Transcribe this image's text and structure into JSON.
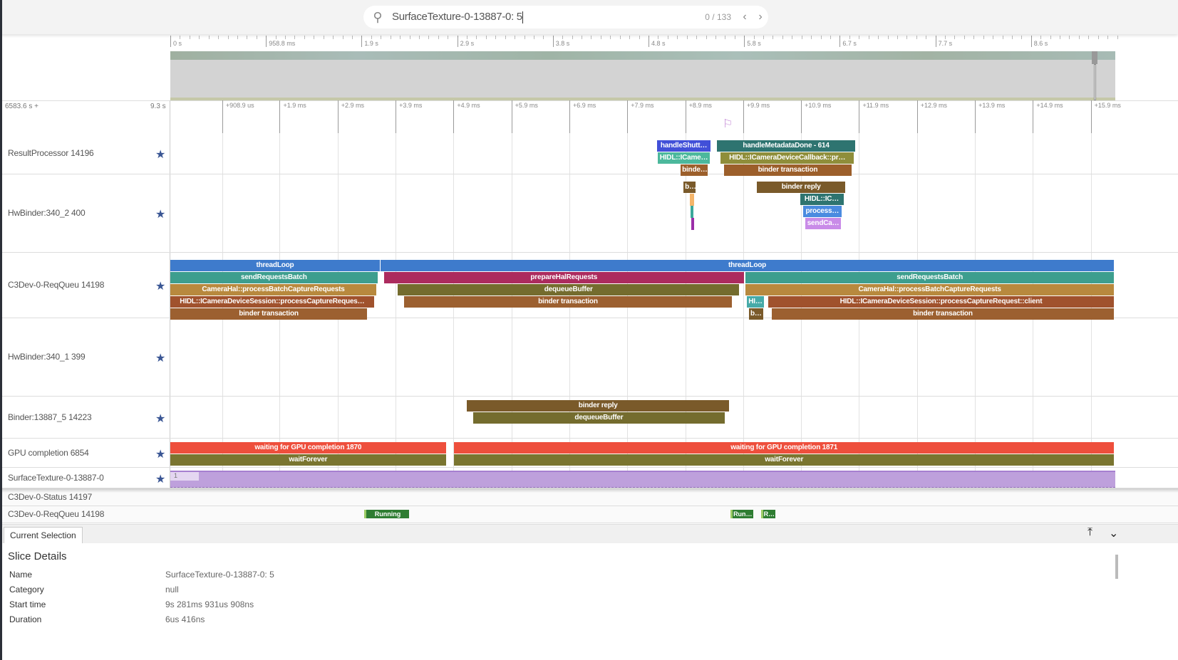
{
  "search": {
    "query": "SurfaceTexture-0-13887-0: 5",
    "count": "0 / 133",
    "icon": "search-icon"
  },
  "overview_ticks": [
    "0 s",
    "958.8 ms",
    "1.9 s",
    "2.9 s",
    "3.8 s",
    "4.8 s",
    "5.8 s",
    "6.7 s",
    "7.7 s",
    "8.6 s"
  ],
  "time_header": {
    "offset": "6583.6 s +",
    "span": "9.3 s"
  },
  "ticks": [
    {
      "t": 0.9089,
      "label": "+908.9 us"
    },
    {
      "t": 1.9,
      "label": "+1.9 ms"
    },
    {
      "t": 2.9,
      "label": "+2.9 ms"
    },
    {
      "t": 3.9,
      "label": "+3.9 ms"
    },
    {
      "t": 4.9,
      "label": "+4.9 ms"
    },
    {
      "t": 5.9,
      "label": "+5.9 ms"
    },
    {
      "t": 6.9,
      "label": "+6.9 ms"
    },
    {
      "t": 7.9,
      "label": "+7.9 ms"
    },
    {
      "t": 8.9,
      "label": "+8.9 ms"
    },
    {
      "t": 9.9,
      "label": "+9.9 ms"
    },
    {
      "t": 10.9,
      "label": "+10.9 ms"
    },
    {
      "t": 11.9,
      "label": "+11.9 ms"
    },
    {
      "t": 12.9,
      "label": "+12.9 ms"
    },
    {
      "t": 13.9,
      "label": "+13.9 ms"
    },
    {
      "t": 14.9,
      "label": "+14.9 ms"
    },
    {
      "t": 15.9,
      "label": "+15.9 ms"
    }
  ],
  "tracks": [
    {
      "name": "ResultProcessor 14196",
      "pinned": true,
      "slices": [
        {
          "s": 8.41,
          "e": 9.34,
          "d": 0,
          "label": "handleShutt…",
          "color": "#4150d8"
        },
        {
          "s": 8.43,
          "e": 9.32,
          "d": 1,
          "label": "HIDL::ICame…",
          "color": "#4cb89c"
        },
        {
          "s": 8.82,
          "e": 9.29,
          "d": 2,
          "label": "binde…",
          "color": "#9c5f2b"
        },
        {
          "s": 9.45,
          "e": 11.83,
          "d": 0,
          "label": "handleMetadataDone - 614",
          "color": "#2e7470"
        },
        {
          "s": 9.51,
          "e": 11.81,
          "d": 1,
          "label": "HIDL::ICameraDeviceCallback::pr…",
          "color": "#8f8e3a"
        },
        {
          "s": 9.57,
          "e": 11.77,
          "d": 2,
          "label": "binder transaction",
          "color": "#9c5f2b"
        }
      ]
    },
    {
      "name": "HwBinder:340_2 400",
      "pinned": true,
      "slices": [
        {
          "s": 8.87,
          "e": 9.08,
          "d": 0,
          "label": "b…",
          "color": "#7a5a2a"
        },
        {
          "s": 8.98,
          "e": 9.05,
          "d": 1,
          "label": "",
          "color": "#f5b56a"
        },
        {
          "s": 8.99,
          "e": 9.04,
          "d": 2,
          "label": "",
          "color": "#3aa89a"
        },
        {
          "s": 9.0,
          "e": 9.03,
          "d": 3,
          "label": "",
          "color": "#9b2fa8"
        },
        {
          "s": 10.14,
          "e": 11.66,
          "d": 0,
          "label": "binder reply",
          "color": "#7a5a2a"
        },
        {
          "s": 10.88,
          "e": 11.63,
          "d": 1,
          "label": "HIDL::IC…",
          "color": "#2e7470"
        },
        {
          "s": 10.93,
          "e": 11.6,
          "d": 2,
          "label": "process…",
          "color": "#4a8be0"
        },
        {
          "s": 10.97,
          "e": 11.59,
          "d": 3,
          "label": "sendCa…",
          "color": "#c98be8"
        }
      ]
    },
    {
      "name": "C3Dev-0-ReqQueu 14198",
      "pinned": true,
      "slices": [
        {
          "s": 0.01,
          "e": 3.63,
          "d": 0,
          "label": "threadLoop",
          "color": "#3e7bcc"
        },
        {
          "s": 3.64,
          "e": 16.3,
          "d": 0,
          "label": "threadLoop",
          "color": "#3e7bcc"
        },
        {
          "s": 0.01,
          "e": 3.59,
          "d": 1,
          "label": "sendRequestsBatch",
          "color": "#3d9e8e"
        },
        {
          "s": 3.7,
          "e": 9.91,
          "d": 1,
          "label": "prepareHalRequests",
          "color": "#ac2b5e"
        },
        {
          "s": 9.94,
          "e": 16.3,
          "d": 1,
          "label": "sendRequestsBatch",
          "color": "#3d9e8e"
        },
        {
          "s": 0.01,
          "e": 3.57,
          "d": 2,
          "label": "CameraHal::processBatchCaptureRequests",
          "color": "#b8893e"
        },
        {
          "s": 3.94,
          "e": 9.83,
          "d": 2,
          "label": "dequeueBuffer",
          "color": "#746c2e"
        },
        {
          "s": 9.94,
          "e": 16.3,
          "d": 2,
          "label": "CameraHal::processBatchCaptureRequests",
          "color": "#b8893e"
        },
        {
          "s": 0.01,
          "e": 3.53,
          "d": 3,
          "label": "HIDL::ICameraDeviceSession::processCaptureReques…",
          "color": "#a0522d"
        },
        {
          "s": 4.05,
          "e": 9.7,
          "d": 3,
          "label": "binder transaction",
          "color": "#9c6030"
        },
        {
          "s": 9.96,
          "e": 10.26,
          "d": 3,
          "label": "HI…",
          "color": "#46aaa8"
        },
        {
          "s": 10.33,
          "e": 16.3,
          "d": 3,
          "label": "HIDL::ICameraDeviceSession::processCaptureRequest::client",
          "color": "#a0522d"
        },
        {
          "s": 0.01,
          "e": 3.41,
          "d": 4,
          "label": "binder transaction",
          "color": "#9c6030"
        },
        {
          "s": 10.0,
          "e": 10.24,
          "d": 4,
          "label": "b…",
          "color": "#7a5a2a"
        },
        {
          "s": 10.39,
          "e": 16.3,
          "d": 4,
          "label": "binder transaction",
          "color": "#9c6030"
        }
      ]
    },
    {
      "name": "HwBinder:340_1 399",
      "pinned": true,
      "slices": []
    },
    {
      "name": "Binder:13887_5 14223",
      "pinned": true,
      "slices": [
        {
          "s": 5.13,
          "e": 9.66,
          "d": 0,
          "label": "binder reply",
          "color": "#7a5a2a"
        },
        {
          "s": 5.24,
          "e": 9.58,
          "d": 1,
          "label": "dequeueBuffer",
          "color": "#746c2e"
        }
      ]
    },
    {
      "name": "GPU completion 6854",
      "pinned": true,
      "slices": [
        {
          "s": 0.01,
          "e": 4.77,
          "d": 0,
          "label": "waiting for GPU completion 1870",
          "color": "#ee4f3c"
        },
        {
          "s": 4.91,
          "e": 16.3,
          "d": 0,
          "label": "waiting for GPU completion 1871",
          "color": "#ee4f3c"
        },
        {
          "s": 0.01,
          "e": 4.77,
          "d": 1,
          "label": "waitForever",
          "color": "#7a7530"
        },
        {
          "s": 4.91,
          "e": 16.3,
          "d": 1,
          "label": "waitForever",
          "color": "#7a7530"
        }
      ]
    },
    {
      "name": "SurfaceTexture-0-13887-0",
      "pinned": true,
      "counter_value": "1"
    },
    {
      "name": "C3Dev-0-Status 14197",
      "pinned": false
    },
    {
      "name": "C3Dev-0-ReqQueu 14198",
      "pinned": false,
      "sched": [
        {
          "s": 3.36,
          "e": 4.13,
          "label": "Running"
        },
        {
          "s": 9.68,
          "e": 10.07,
          "label": "Run…"
        },
        {
          "s": 10.21,
          "e": 10.45,
          "label": "R…"
        }
      ]
    }
  ],
  "panel": {
    "tab": "Current Selection",
    "title": "Slice Details",
    "rows": [
      {
        "k": "Name",
        "v": "SurfaceTexture-0-13887-0: 5"
      },
      {
        "k": "Category",
        "v": "null"
      },
      {
        "k": "Start time",
        "v": "9s 281ms 931us 908ns"
      },
      {
        "k": "Duration",
        "v": "6us 416ns"
      }
    ]
  },
  "colors": {
    "star": "#3a5694",
    "flag": "#c58ad6",
    "counter": "#bea0dc"
  }
}
